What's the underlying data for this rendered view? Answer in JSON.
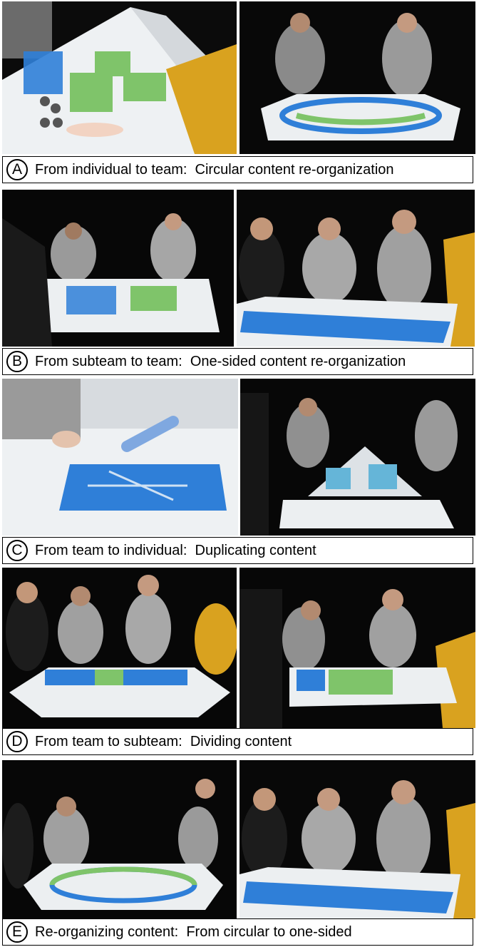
{
  "rows": [
    {
      "letter": "A",
      "caption": "From individual to team:  Circular content re-organization",
      "photos": [
        {
          "name": "photo-a-left-pyramid-touch"
        },
        {
          "name": "photo-a-right-circular-table"
        }
      ]
    },
    {
      "letter": "B",
      "caption": "From subteam to team:  One-sided content re-organization",
      "photos": [
        {
          "name": "photo-b-left-subteam"
        },
        {
          "name": "photo-b-right-team"
        }
      ]
    },
    {
      "letter": "C",
      "caption": "From team to individual:  Duplicating content",
      "photos": [
        {
          "name": "photo-c-left-hand-tile"
        },
        {
          "name": "photo-c-right-pyramid"
        }
      ]
    },
    {
      "letter": "D",
      "caption": "From team to subteam:  Dividing content",
      "photos": [
        {
          "name": "photo-d-left-team-table"
        },
        {
          "name": "photo-d-right-subteam"
        }
      ]
    },
    {
      "letter": "E",
      "caption": "Re-organizing content:  From circular to one-sided",
      "photos": [
        {
          "name": "photo-e-left-circular"
        },
        {
          "name": "photo-e-right-one-sided"
        }
      ]
    }
  ],
  "colors": {
    "background": "#000000",
    "table": "#e9ecef",
    "blue_content": "#2f7fd8",
    "green_content": "#7fc46a",
    "yellow_shirt": "#d9a21f",
    "caption_border": "#000000"
  }
}
